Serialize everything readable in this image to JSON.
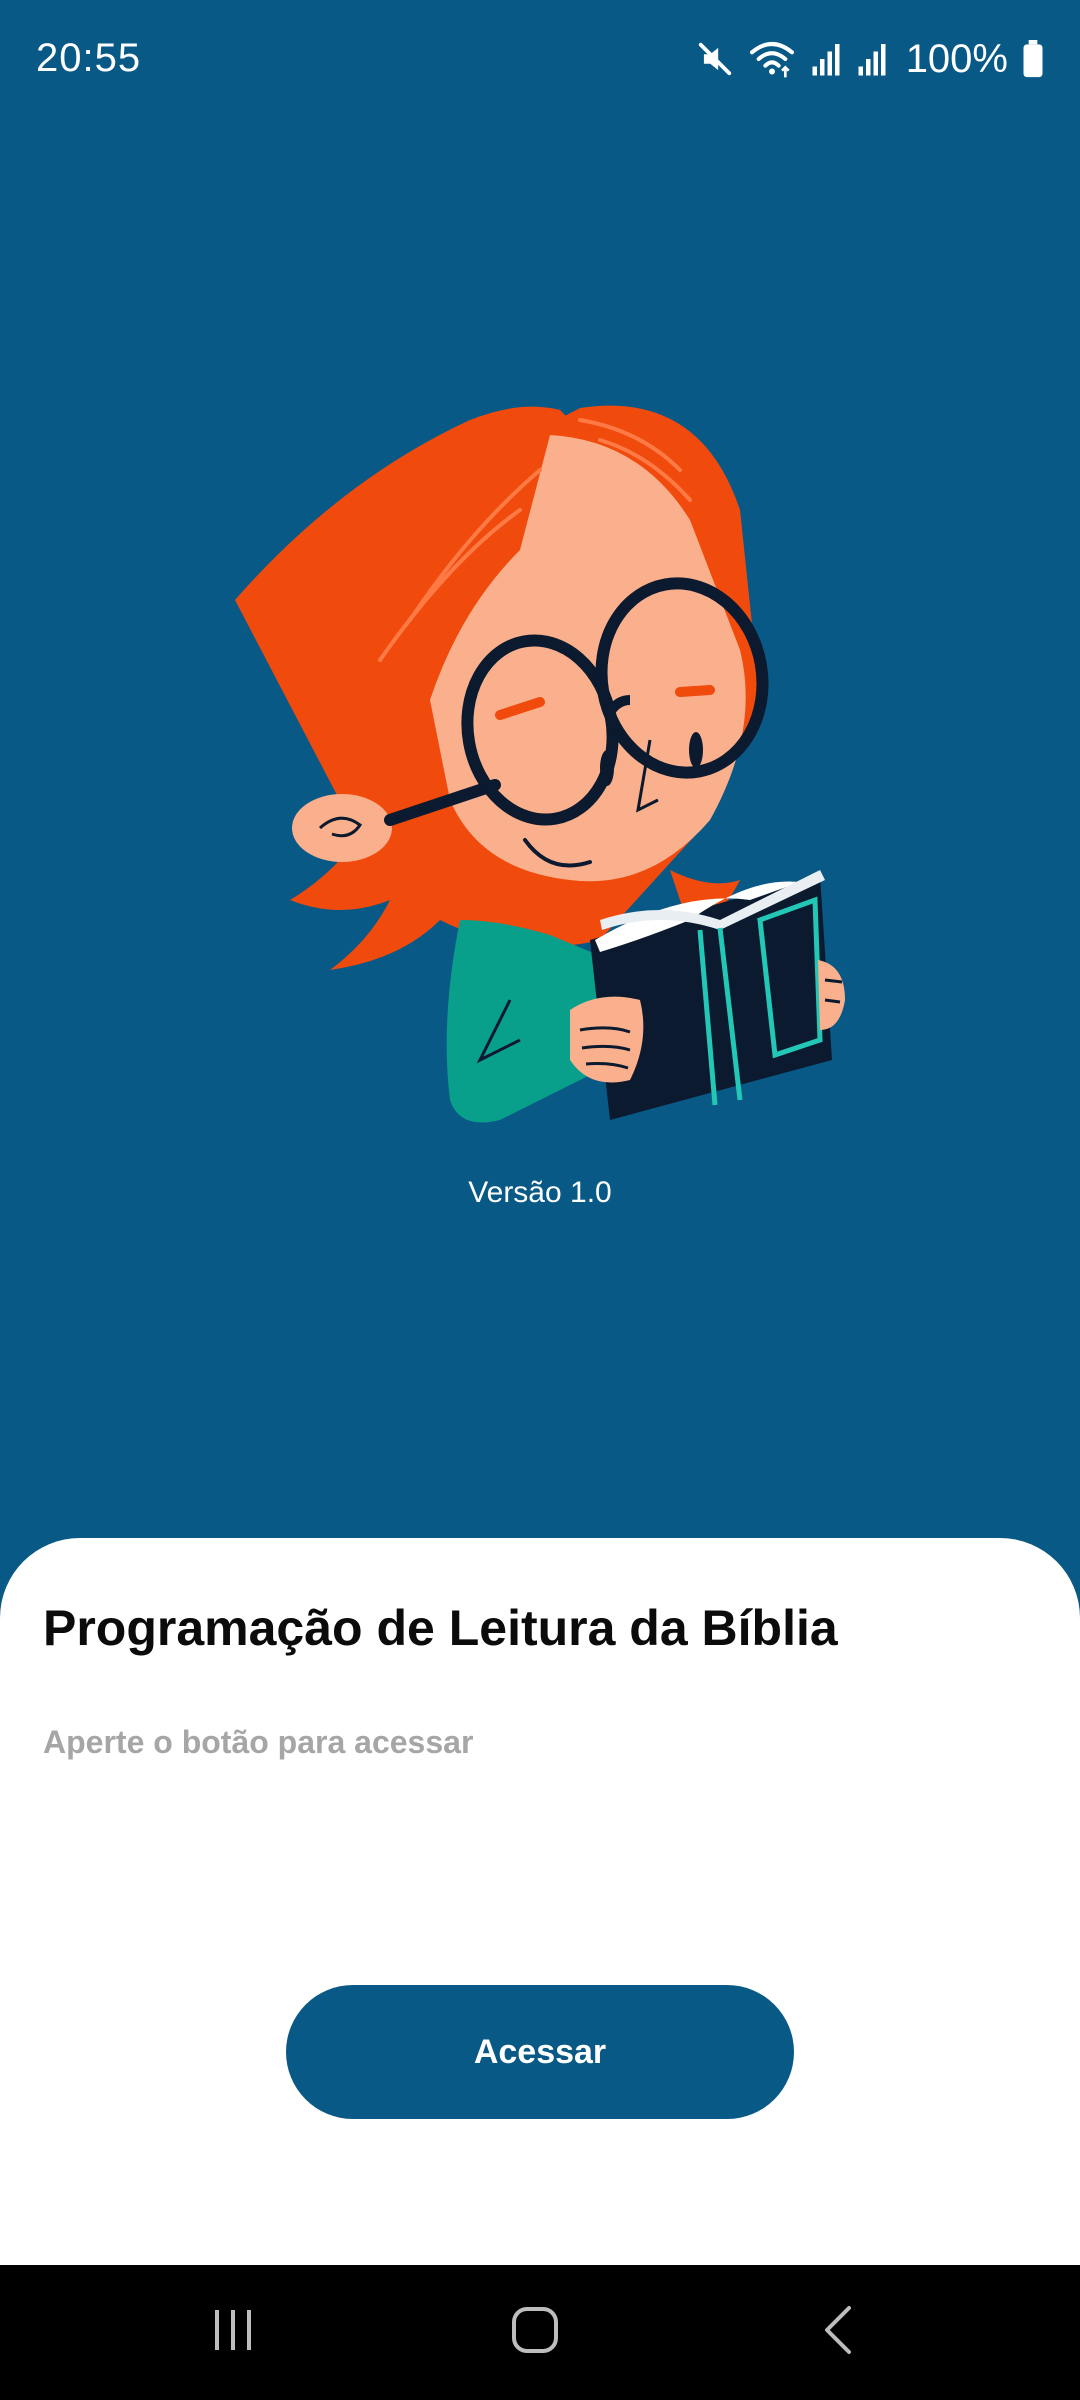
{
  "status_bar": {
    "time": "20:55",
    "battery_percent": "100%",
    "icons": [
      "mute-icon",
      "wifi-icon",
      "signal-icon",
      "signal-icon",
      "battery-icon"
    ]
  },
  "splash": {
    "illustration": "child-reading-bible-illustration",
    "version": "Versão 1.0"
  },
  "sheet": {
    "title": "Programação de Leitura da Bíblia",
    "subtitle": "Aperte o botão para acessar",
    "button_label": "Acessar"
  },
  "nav_bar": {
    "icons": [
      "recent-apps-icon",
      "home-icon",
      "back-icon"
    ]
  },
  "colors": {
    "primary": "#085986",
    "hair": "#f04a0d",
    "skin": "#fbb08d",
    "shirt": "#08a08b",
    "book": "#0b1a2e",
    "book_accent": "#22c7b6"
  }
}
